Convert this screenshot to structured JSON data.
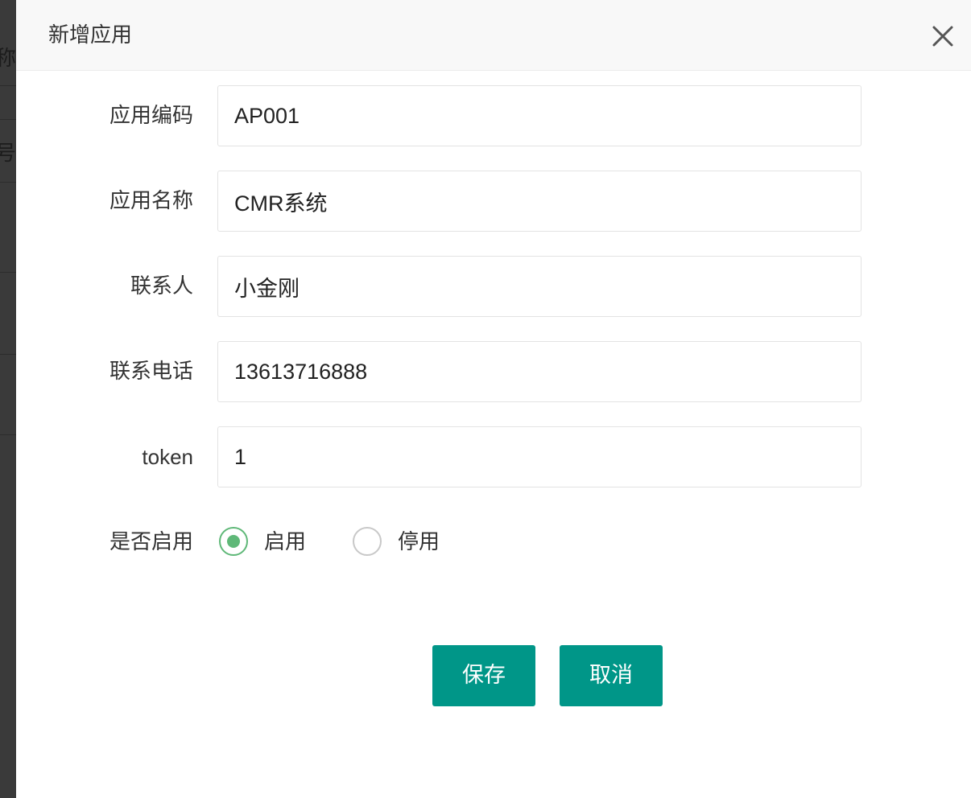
{
  "background": {
    "partial_text_1": "称",
    "partial_text_2": "号"
  },
  "dialog": {
    "title": "新增应用",
    "close_icon": "close-icon"
  },
  "form": {
    "app_code": {
      "label": "应用编码",
      "value": "AP001"
    },
    "app_name": {
      "label": "应用名称",
      "value": "CMR系统"
    },
    "contact": {
      "label": "联系人",
      "value": "小金刚"
    },
    "phone": {
      "label": "联系电话",
      "value": "13613716888"
    },
    "token": {
      "label": "token",
      "value": "1"
    },
    "enabled": {
      "label": "是否启用",
      "options": [
        {
          "label": "启用",
          "checked": true
        },
        {
          "label": "停用",
          "checked": false
        }
      ]
    }
  },
  "buttons": {
    "save_label": "保存",
    "cancel_label": "取消"
  },
  "colors": {
    "primary": "#009688",
    "radio_checked": "#5fb878",
    "header_bg": "#f8f8f8"
  }
}
